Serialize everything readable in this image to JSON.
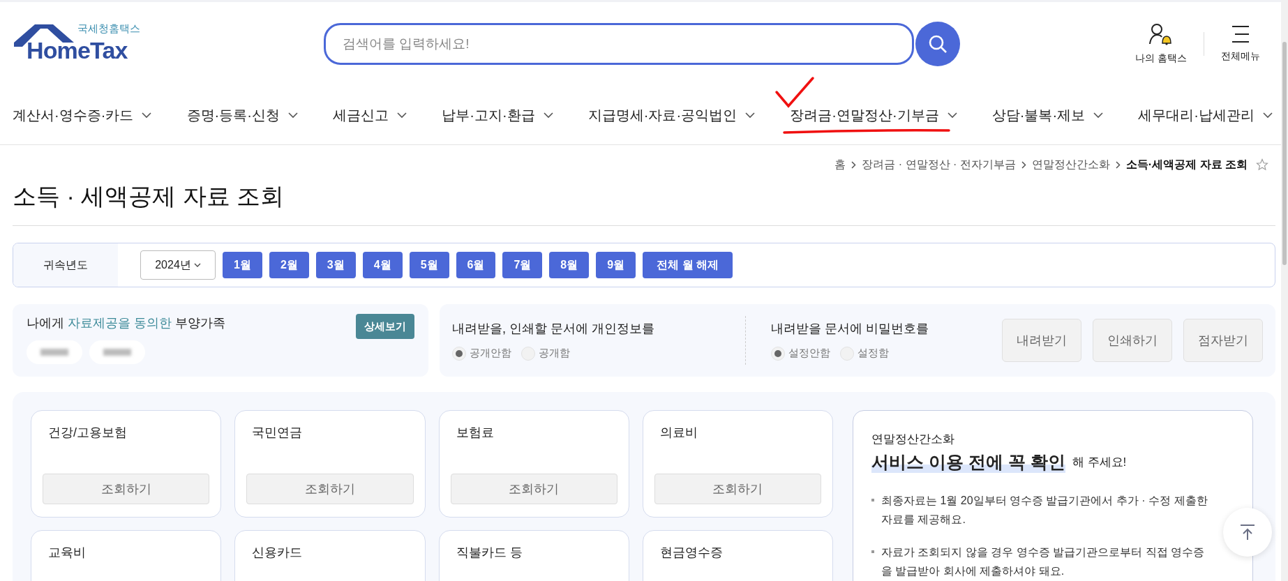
{
  "header": {
    "logo_caption": "국세청홈택스",
    "logo_text": "HomeTax",
    "search": {
      "placeholder": "검색어를 입력하세요!"
    },
    "actions": [
      {
        "kind": "my",
        "label": "나의 홈택스"
      },
      {
        "kind": "menu",
        "label": "전체메뉴"
      }
    ]
  },
  "nav": [
    {
      "label": "계산서·영수증·카드",
      "highlighted": false
    },
    {
      "label": "증명·등록·신청",
      "highlighted": false
    },
    {
      "label": "세금신고",
      "highlighted": false
    },
    {
      "label": "납부·고지·환급",
      "highlighted": false
    },
    {
      "label": "지급명세·자료·공익법인",
      "highlighted": false
    },
    {
      "label": "장려금·연말정산·기부금",
      "highlighted": true
    },
    {
      "label": "상담·불복·제보",
      "highlighted": false
    },
    {
      "label": "세무대리·납세관리",
      "highlighted": false
    }
  ],
  "breadcrumb": [
    "홈",
    "장려금 · 연말정산 · 전자기부금",
    "연말정산간소화",
    "소득·세액공제 자료 조회"
  ],
  "page_title": "소득 · 세액공제 자료 조회",
  "filter": {
    "label": "귀속년도",
    "year": "2024년",
    "months": [
      "1월",
      "2월",
      "3월",
      "4월",
      "5월",
      "6월",
      "7월",
      "8월",
      "9월"
    ],
    "clear": "전체 월 해제"
  },
  "dependents": {
    "title": "나에게 **자료제공을 동의한** 부양가족",
    "detail_button": "상세보기"
  },
  "options": [
    {
      "title": "내려받을, 인쇄할 문서에 개인정보를",
      "choices": [
        {
          "label": "공개안함",
          "selected": true
        },
        {
          "label": "공개함",
          "selected": false
        }
      ]
    },
    {
      "title": "내려받을 문서에 비밀번호를",
      "choices": [
        {
          "label": "설정안함",
          "selected": true
        },
        {
          "label": "설정함",
          "selected": false
        }
      ]
    }
  ],
  "doc_buttons": [
    "내려받기",
    "인쇄하기",
    "점자받기"
  ],
  "categories": [
    {
      "name": "건강/고용보험",
      "button": "조회하기"
    },
    {
      "name": "국민연금",
      "button": "조회하기"
    },
    {
      "name": "보험료",
      "button": "조회하기"
    },
    {
      "name": "의료비",
      "button": "조회하기"
    },
    {
      "name": "교육비"
    },
    {
      "name": "신용카드"
    },
    {
      "name": "직불카드 등"
    },
    {
      "name": "현금영수증"
    }
  ],
  "notice": {
    "subtitle": "연말정산간소화",
    "headline_emphasis": "서비스 이용 전에 꼭 확인",
    "headline_rest": "해 주세요!",
    "items": [
      "최종자료는 1월 20일부터 영수증 발급기관에서 추가 · 수정 제출한 자료를 제공해요.",
      "자료가 조회되지 않을 경우 영수증 발급기관으로부터 직접 영수증을 발급받아 회사에 제출하셔야 돼요."
    ]
  }
}
